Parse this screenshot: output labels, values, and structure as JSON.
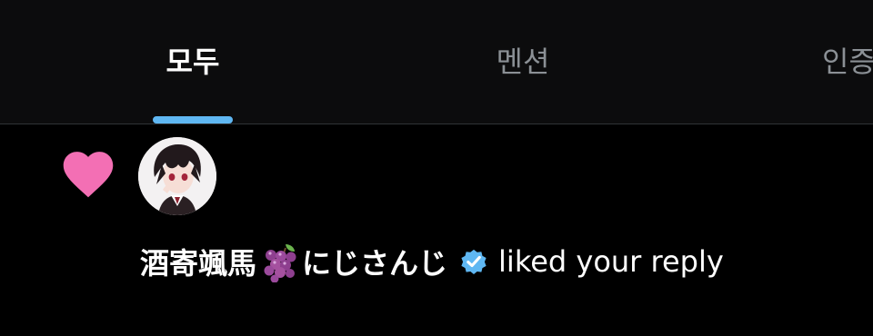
{
  "tabs": [
    {
      "label": "모두",
      "active": true
    },
    {
      "label": "멘션",
      "active": false
    },
    {
      "label": "인증",
      "active": false
    }
  ],
  "notification": {
    "type_icon": "heart-icon",
    "user": {
      "name": "酒寄颯馬",
      "emoji": "grapes-icon",
      "suffix": "にじさんじ",
      "verified": true
    },
    "action": "liked your reply"
  },
  "colors": {
    "background": "#000000",
    "tabbar_background": "#0c0c0d",
    "active_tab_text": "#ffffff",
    "inactive_tab_text": "#8b9095",
    "tab_indicator": "#5fb7f2",
    "heart": "#f36fb4",
    "verified_badge": "#5fb7f2",
    "divider": "#2f3336"
  }
}
